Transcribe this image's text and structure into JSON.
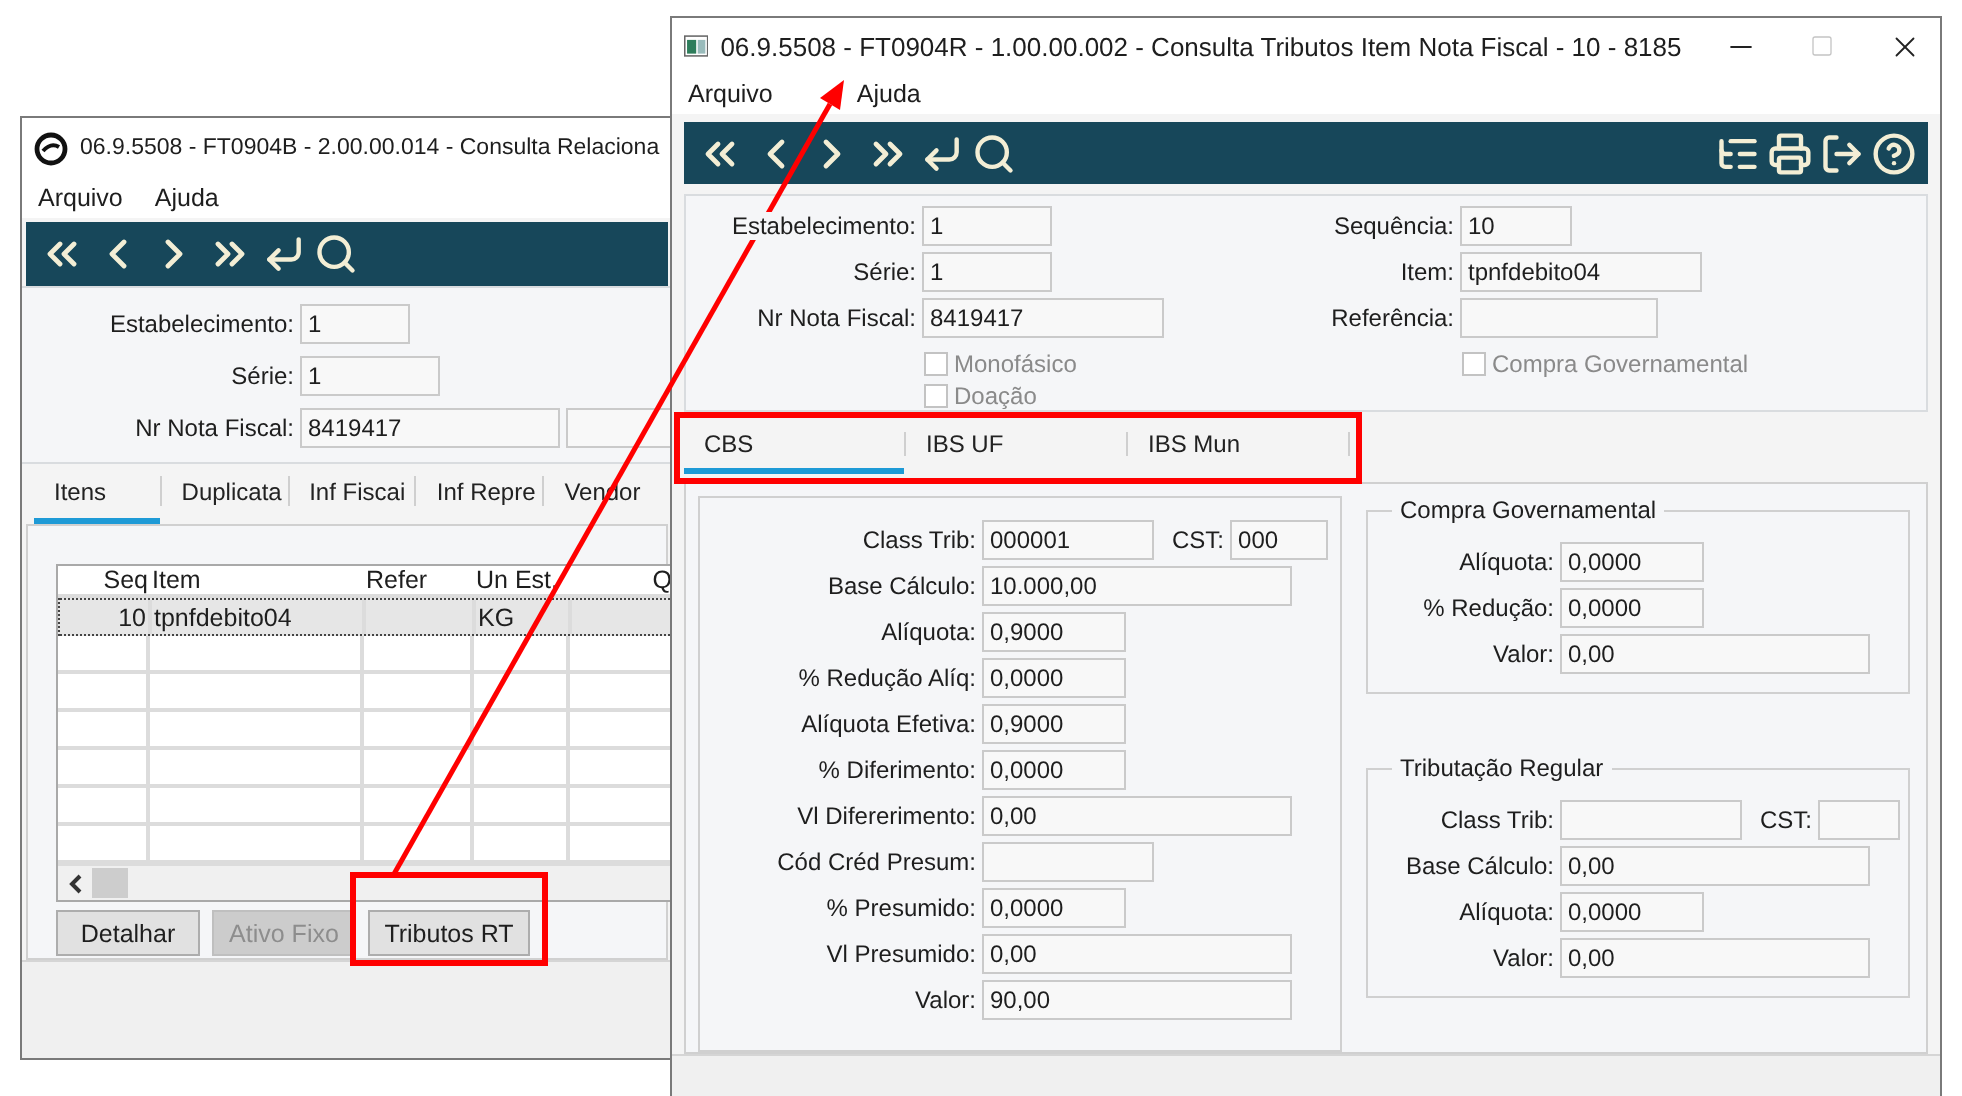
{
  "back_window": {
    "title": "06.9.5508 - FT0904B - 2.00.00.014 - Consulta Relaciona",
    "menu": [
      "Arquivo",
      "Ajuda"
    ],
    "fields": [
      {
        "label": "Estabelecimento:",
        "value": "1"
      },
      {
        "label": "Série:",
        "value": "1"
      },
      {
        "label": "Nr Nota Fiscal:",
        "value": "8419417"
      }
    ],
    "tabs": [
      {
        "label": "Itens",
        "selected": true
      },
      {
        "label": "Duplicata",
        "selected": false
      },
      {
        "label": "Inf Fiscai",
        "selected": false
      },
      {
        "label": "Inf Repre",
        "selected": false
      },
      {
        "label": "Vendor",
        "selected": false
      }
    ],
    "table": {
      "columns": [
        "Seq",
        "Item",
        "Refer",
        "Un Est.",
        "Q"
      ],
      "rows": [
        {
          "seq": "10",
          "item": "tpnfdebito04",
          "un_est": "KG",
          "selected": true
        }
      ]
    },
    "buttons": [
      {
        "label": "Detalhar",
        "disabled": false
      },
      {
        "label": "Ativo Fixo",
        "disabled": true
      },
      {
        "label": "Tributos RT",
        "disabled": false
      }
    ]
  },
  "front_window": {
    "title": "06.9.5508 - FT0904R - 1.00.00.002 - Consulta Tributos Item Nota Fiscal - 10 - 8185",
    "controls": [
      {
        "kind": "minimize",
        "disabled": false
      },
      {
        "kind": "maximize",
        "disabled": true
      },
      {
        "kind": "close",
        "disabled": false
      }
    ],
    "menu": [
      "Arquivo",
      "Ajuda"
    ],
    "header_left": [
      {
        "label": "Estabelecimento:",
        "value": "1"
      },
      {
        "label": "Série:",
        "value": "1"
      },
      {
        "label": "Nr Nota Fiscal:",
        "value": "8419417"
      }
    ],
    "header_left_checks": [
      {
        "label": "Monofásico",
        "checked": false,
        "disabled": true
      },
      {
        "label": "Doação",
        "checked": false,
        "disabled": true
      }
    ],
    "header_right": [
      {
        "label": "Sequência:",
        "value": "10"
      },
      {
        "label": "Item:",
        "value": "tpnfdebito04"
      },
      {
        "label": "Referência:"
      }
    ],
    "header_right_checks": [
      {
        "label": "Compra Governamental",
        "checked": false,
        "disabled": true
      }
    ],
    "tabs": [
      {
        "label": "CBS",
        "selected": true
      },
      {
        "label": "IBS UF",
        "selected": false
      },
      {
        "label": "IBS Mun",
        "selected": false
      }
    ],
    "cbs_fields": [
      {
        "label": "Class Trib:",
        "value": "000001",
        "kind": "code",
        "extra": {
          "label": "CST:",
          "value": "000"
        }
      },
      {
        "label": "Base Cálculo:",
        "value": "10.000,00",
        "kind": "amount"
      },
      {
        "label": "Alíquota:",
        "value": "0,9000",
        "kind": "rate"
      },
      {
        "label": "% Redução Alíq:",
        "value": "0,0000",
        "kind": "rate"
      },
      {
        "label": "Alíquota Efetiva:",
        "value": "0,9000",
        "kind": "rate"
      },
      {
        "label": "% Diferimento:",
        "value": "0,0000",
        "kind": "rate"
      },
      {
        "label": "Vl Difererimento:",
        "value": "0,00",
        "kind": "amount"
      },
      {
        "label": "Cód Créd Presum:",
        "kind": "code"
      },
      {
        "label": "% Presumido:",
        "value": "0,0000",
        "kind": "rate"
      },
      {
        "label": "Vl Presumido:",
        "value": "0,00",
        "kind": "amount"
      },
      {
        "label": "Valor:",
        "value": "90,00",
        "kind": "amount"
      }
    ],
    "groups": [
      {
        "title": "Compra Governamental",
        "fields": [
          {
            "label": "Alíquota:",
            "value": "0,0000",
            "kind": "rate"
          },
          {
            "label": "% Redução:",
            "value": "0,0000",
            "kind": "rate"
          },
          {
            "label": "Valor:",
            "value": "0,00",
            "kind": "amount"
          }
        ]
      },
      {
        "title": "Tributação Regular",
        "fields": [
          {
            "label": "Class Trib:",
            "kind": "code",
            "extra": {
              "label": "CST:"
            }
          },
          {
            "label": "Base Cálculo:",
            "value": "0,00",
            "kind": "amount"
          },
          {
            "label": "Alíquota:",
            "value": "0,0000",
            "kind": "rate"
          },
          {
            "label": "Valor:",
            "value": "0,00",
            "kind": "amount"
          }
        ]
      }
    ]
  }
}
